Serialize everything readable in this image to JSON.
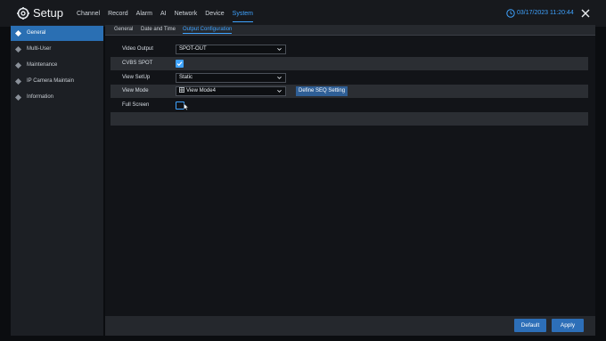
{
  "app": {
    "title": "Setup"
  },
  "nav": {
    "items": [
      "Channel",
      "Record",
      "Alarm",
      "AI",
      "Network",
      "Device",
      "System"
    ],
    "active": "System"
  },
  "header": {
    "datetime": "03/17/2023 11:20:44"
  },
  "sidebar": {
    "items": [
      "General",
      "Multi-User",
      "Maintenance",
      "IP Camera Maintain",
      "Information"
    ],
    "active": "General"
  },
  "subtabs": {
    "items": [
      "General",
      "Date and Time",
      "Output Configuration"
    ],
    "active": "Output Configuration"
  },
  "form": {
    "video_output": {
      "label": "Video Output",
      "value": "SPOT-OUT"
    },
    "cvbs_spot": {
      "label": "CVBS SPOT",
      "checked": true
    },
    "view_setup": {
      "label": "View SetUp",
      "value": "Static"
    },
    "view_mode": {
      "label": "View Mode",
      "value": "View Mode4",
      "seq_button": "Define SEQ Setting"
    },
    "full_screen": {
      "label": "Full Screen",
      "checked": false
    }
  },
  "footer": {
    "default_label": "Default",
    "apply_label": "Apply"
  },
  "colors": {
    "accent": "#3fa3ff",
    "active_bg": "#2a6fb3",
    "button": "#2d6fb8"
  }
}
